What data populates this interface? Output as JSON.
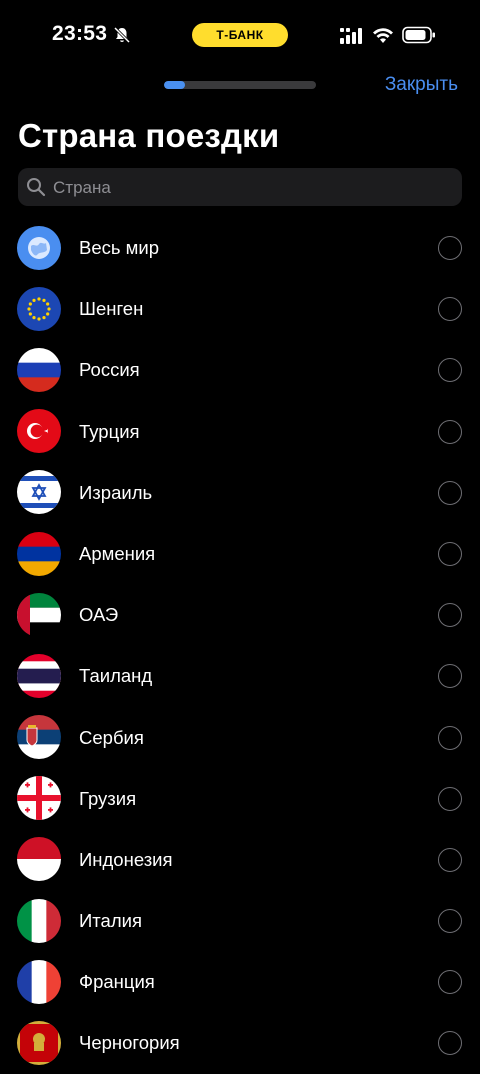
{
  "status_bar": {
    "time": "23:53",
    "brand": "Т-БАНК",
    "icons": [
      "bell-slash-icon",
      "signal-icon",
      "wifi-icon",
      "battery-icon"
    ]
  },
  "progress": {
    "fraction": 0.14
  },
  "header": {
    "close_label": "Закрыть",
    "title": "Страна поездки"
  },
  "search": {
    "placeholder": "Страна",
    "value": ""
  },
  "colors": {
    "accent": "#4a8ef0",
    "brand": "#ffdd2d",
    "background": "#000000"
  },
  "countries": [
    {
      "name": "Весь мир",
      "flag": "globe"
    },
    {
      "name": "Шенген",
      "flag": "eu"
    },
    {
      "name": "Россия",
      "flag": "ru"
    },
    {
      "name": "Турция",
      "flag": "tr"
    },
    {
      "name": "Израиль",
      "flag": "il"
    },
    {
      "name": "Армения",
      "flag": "am"
    },
    {
      "name": "ОАЭ",
      "flag": "ae"
    },
    {
      "name": "Таиланд",
      "flag": "th"
    },
    {
      "name": "Сербия",
      "flag": "rs"
    },
    {
      "name": "Грузия",
      "flag": "ge"
    },
    {
      "name": "Индонезия",
      "flag": "id"
    },
    {
      "name": "Италия",
      "flag": "it"
    },
    {
      "name": "Франция",
      "flag": "fr"
    },
    {
      "name": "Черногория",
      "flag": "me"
    }
  ]
}
